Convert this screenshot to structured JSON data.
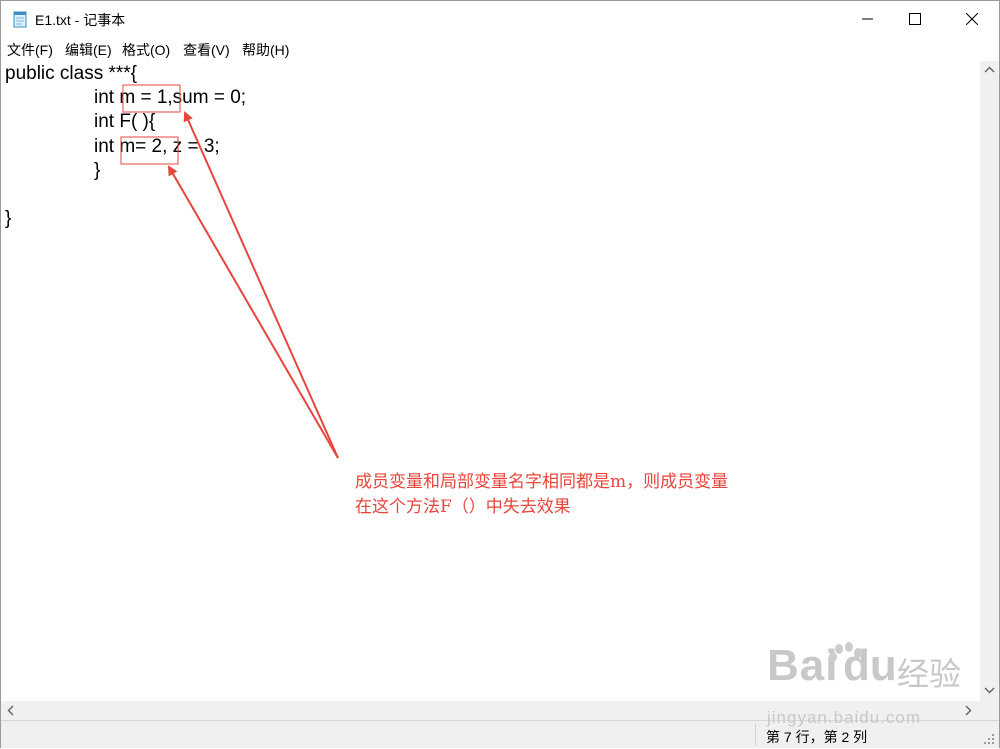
{
  "window": {
    "title": "E1.txt - 记事本",
    "controls": {
      "minimize": "—",
      "maximize": "☐",
      "close": "✕"
    }
  },
  "menu": {
    "items": [
      {
        "label": "文件(F)"
      },
      {
        "label": "编辑(E)"
      },
      {
        "label": "格式(O)"
      },
      {
        "label": "查看(V)"
      },
      {
        "label": "帮助(H)"
      }
    ]
  },
  "editor": {
    "lines": [
      "public class ***{",
      "int m = 1,sum = 0;",
      "int F( ){",
      "int m= 2, z = 3;",
      "}",
      "",
      "}"
    ]
  },
  "status": {
    "position": "第 7 行，第 2 列"
  },
  "annotation": {
    "lines": [
      "成员变量和局部变量名字相同都是m，则成员变量",
      "在这个方法F（）中失去效果"
    ],
    "color": "#e8453c"
  },
  "watermark": {
    "brand": "Bai",
    "brand2": "du",
    "brand_cn": "经验",
    "url": "jingyan.baidu.com"
  },
  "colors": {
    "annotation": "#e8453c",
    "chrome": "#f0f0f0"
  }
}
